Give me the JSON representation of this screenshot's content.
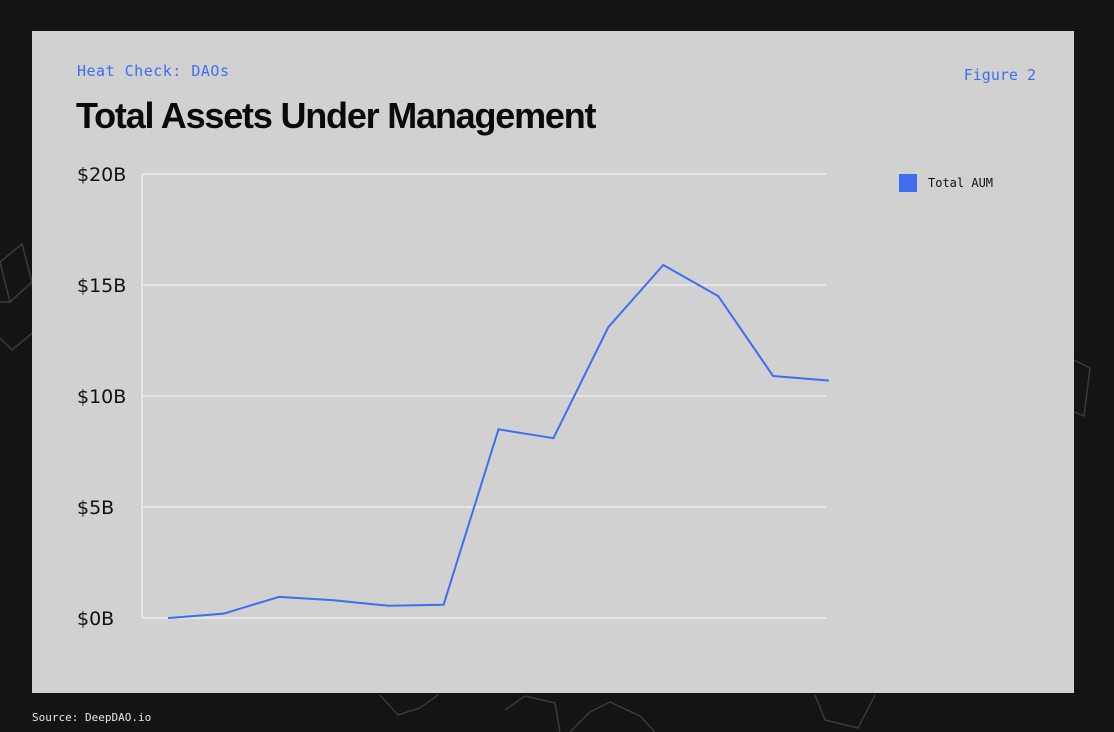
{
  "header": {
    "kicker": "Heat Check: DAOs",
    "figure_label": "Figure 2",
    "title": "Total Assets Under Management"
  },
  "footer": {
    "source": "Source: DeepDAO.io"
  },
  "colors": {
    "accent": "#3f6ef0",
    "card_background": "#d1d1d1",
    "page_background": "#141414"
  },
  "chart_data": {
    "type": "line",
    "title": "Total Assets Under Management",
    "xlabel": "",
    "ylabel": "",
    "x": [
      0,
      1,
      2,
      3,
      4,
      5,
      6,
      7,
      8,
      9,
      10,
      11,
      12
    ],
    "series": [
      {
        "name": "Total AUM",
        "color": "#3f6ef0",
        "values": [
          0.0,
          0.2,
          0.95,
          0.8,
          0.55,
          0.6,
          8.5,
          8.1,
          13.1,
          15.9,
          14.5,
          10.9,
          10.7
        ]
      }
    ],
    "ylim": [
      0,
      20
    ],
    "yticks": [
      0,
      5,
      10,
      15,
      20
    ],
    "ytick_labels": [
      "$0B",
      "$5B",
      "$10B",
      "$15B",
      "$20B"
    ],
    "grid": true,
    "legend_position": "top-right"
  }
}
